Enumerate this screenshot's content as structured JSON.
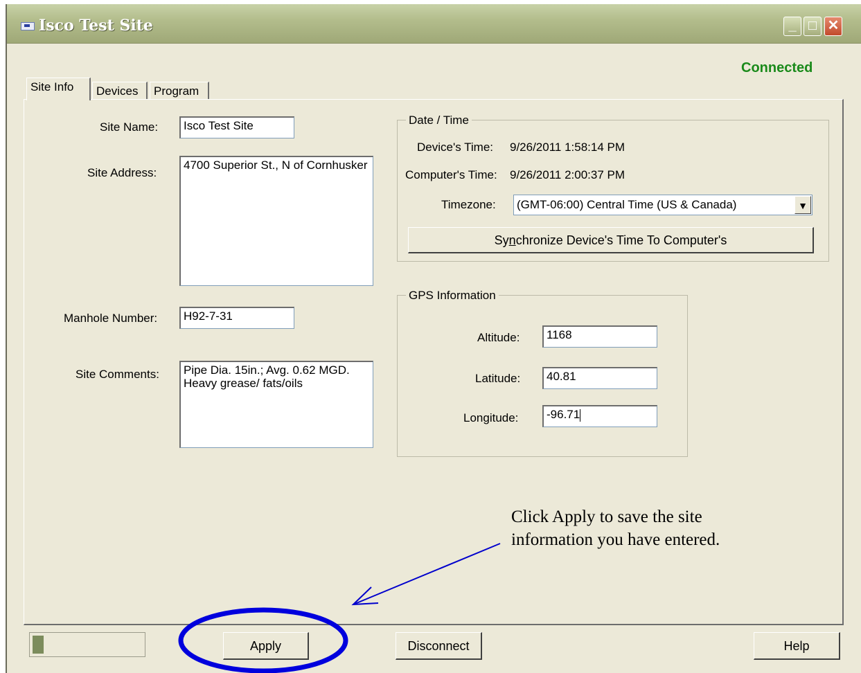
{
  "window": {
    "title": "Isco Test Site",
    "status": "Connected",
    "status_color": "#1a8a1a",
    "min_glyph": "_",
    "max_glyph": "□",
    "close_glyph": "✕"
  },
  "tabs": [
    {
      "label": "Site Info",
      "active": true
    },
    {
      "label": "Devices",
      "active": false
    },
    {
      "label": "Program",
      "active": false
    }
  ],
  "site": {
    "name_label": "Site Name:",
    "name_value": "Isco Test Site",
    "address_label": "Site Address:",
    "address_value": "4700 Superior St., N of Cornhusker",
    "manhole_label": "Manhole Number:",
    "manhole_value": "H92-7-31",
    "comments_label": "Site Comments:",
    "comments_value": "Pipe Dia. 15in.; Avg. 0.62 MGD. Heavy grease/ fats/oils"
  },
  "datetime": {
    "group_title": "Date / Time",
    "device_time_label": "Device's Time:",
    "device_time_value": "9/26/2011 1:58:14 PM",
    "computer_time_label": "Computer's Time:",
    "computer_time_value": "9/26/2011 2:00:37 PM",
    "timezone_label": "Timezone:",
    "timezone_value": "(GMT-06:00) Central Time (US & Canada)",
    "sync_prefix": "Sy",
    "sync_underlined": "n",
    "sync_suffix": "chronize Device's Time To Computer's"
  },
  "gps": {
    "group_title": "GPS Information",
    "altitude_label": "Altitude:",
    "altitude_value": "1168",
    "latitude_label": "Latitude:",
    "latitude_value": "40.81",
    "longitude_label": "Longitude:",
    "longitude_value": "-96.71"
  },
  "buttons": {
    "apply": "Apply",
    "disconnect": "Disconnect",
    "help": "Help"
  },
  "progress": {
    "fraction": 0.1
  },
  "annotation": {
    "text": "Click Apply to save the site information you have entered.",
    "color": "#0000cc"
  }
}
